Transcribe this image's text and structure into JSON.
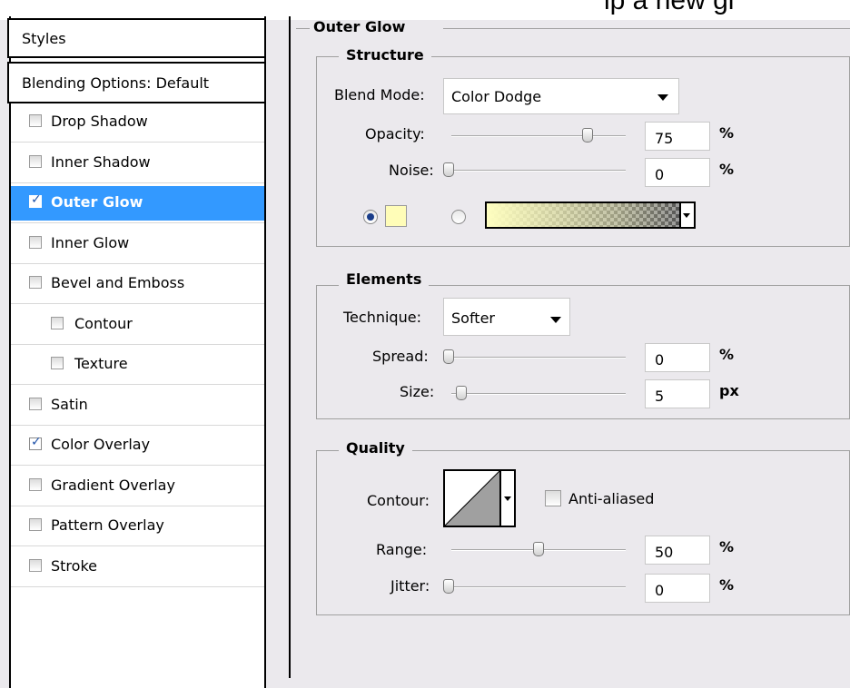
{
  "top_fragment": "ip a new gl",
  "styles_panel": {
    "header": "Styles",
    "blending": "Blending Options: Default",
    "items": [
      {
        "label": "Drop Shadow",
        "checked": false,
        "selected": false,
        "indent": false
      },
      {
        "label": "Inner Shadow",
        "checked": false,
        "selected": false,
        "indent": false
      },
      {
        "label": "Outer Glow",
        "checked": true,
        "selected": true,
        "indent": false
      },
      {
        "label": "Inner Glow",
        "checked": false,
        "selected": false,
        "indent": false
      },
      {
        "label": "Bevel and Emboss",
        "checked": false,
        "selected": false,
        "indent": false
      },
      {
        "label": "Contour",
        "checked": false,
        "selected": false,
        "indent": true
      },
      {
        "label": "Texture",
        "checked": false,
        "selected": false,
        "indent": true
      },
      {
        "label": "Satin",
        "checked": false,
        "selected": false,
        "indent": false
      },
      {
        "label": "Color Overlay",
        "checked": true,
        "selected": false,
        "indent": false
      },
      {
        "label": "Gradient Overlay",
        "checked": false,
        "selected": false,
        "indent": false
      },
      {
        "label": "Pattern Overlay",
        "checked": false,
        "selected": false,
        "indent": false
      },
      {
        "label": "Stroke",
        "checked": false,
        "selected": false,
        "indent": false
      }
    ]
  },
  "outer_glow": {
    "title": "Outer Glow",
    "structure": {
      "title": "Structure",
      "blend_mode_label": "Blend Mode:",
      "blend_mode_value": "Color Dodge",
      "opacity_label": "Opacity:",
      "opacity_value": "75",
      "opacity_unit": "%",
      "noise_label": "Noise:",
      "noise_value": "0",
      "noise_unit": "%",
      "color_swatch": "#fffdb8",
      "gradient_start": "#ffffc0"
    },
    "elements": {
      "title": "Elements",
      "technique_label": "Technique:",
      "technique_value": "Softer",
      "spread_label": "Spread:",
      "spread_value": "0",
      "spread_unit": "%",
      "size_label": "Size:",
      "size_value": "5",
      "size_unit": "px"
    },
    "quality": {
      "title": "Quality",
      "contour_label": "Contour:",
      "anti_aliased_label": "Anti-aliased",
      "anti_aliased_checked": false,
      "range_label": "Range:",
      "range_value": "50",
      "range_unit": "%",
      "jitter_label": "Jitter:",
      "jitter_value": "0",
      "jitter_unit": "%"
    }
  },
  "colors": {
    "selection": "#3399ff",
    "panel_bg": "#ebe9ed"
  }
}
